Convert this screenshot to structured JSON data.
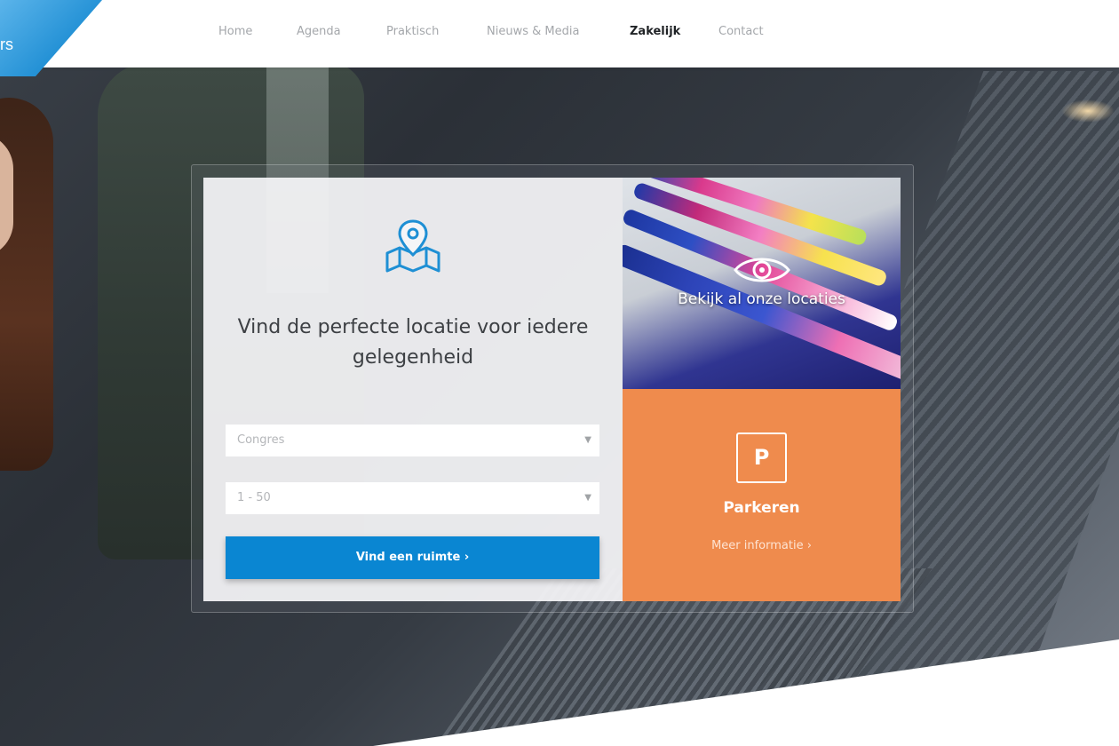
{
  "brand": {
    "logo_text": "rs",
    "accent_color": "#0a86d2",
    "orange_color": "#ef8b4d"
  },
  "nav": {
    "items": [
      {
        "label": "Home",
        "active": false
      },
      {
        "label": "Agenda",
        "active": false
      },
      {
        "label": "Praktisch",
        "active": false
      },
      {
        "label": "Nieuws & Media",
        "active": false
      },
      {
        "label": "Zakelijk",
        "active": true
      },
      {
        "label": "Contact",
        "active": false
      }
    ]
  },
  "search": {
    "icon": "map-pin-icon",
    "heading": "Vind de perfecte locatie voor iedere gelegenheid",
    "type_select": {
      "value": "Congres"
    },
    "size_select": {
      "value": "1 - 50"
    },
    "button_label": "Vind een ruimte ›"
  },
  "locations": {
    "icon": "eye-icon",
    "label": "Bekijk al onze locaties"
  },
  "parking": {
    "icon": "parking-icon",
    "icon_letter": "P",
    "title": "Parkeren",
    "link_label": "Meer informatie ›"
  }
}
